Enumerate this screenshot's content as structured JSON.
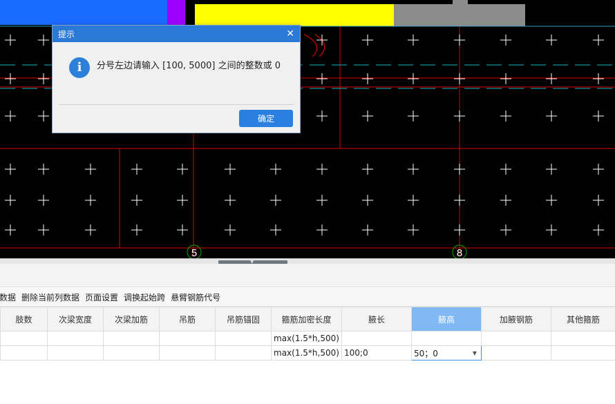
{
  "canvas": {
    "axis_labels": [
      "5",
      "8"
    ],
    "colors": {
      "background": "#000000",
      "beam_line": "#e00000",
      "dash_line": "#19b8c8",
      "cross": "#ffffff",
      "yellow_block": "#ffff00",
      "gray_block": "#8c8c8c",
      "blue_block": "#1a6cff",
      "purple_block": "#9b00ff"
    }
  },
  "dialog": {
    "title": "提示",
    "message": "分号左边请输入 [100, 5000] 之间的整数或 0",
    "ok_label": "确定",
    "icon": "info-icon"
  },
  "toolbar": {
    "items": [
      "数据",
      "删除当前列数据",
      "页面设置",
      "调换起始跨",
      "悬臂钢筋代号"
    ]
  },
  "table": {
    "columns": [
      "肢数",
      "次梁宽度",
      "次梁加筋",
      "吊筋",
      "吊筋锚固",
      "箍筋加密长度",
      "腋长",
      "腋高",
      "加腋钢筋",
      "其他箍筋"
    ],
    "selected_column": "腋高",
    "rows": [
      [
        "",
        "",
        "",
        "",
        "",
        "max(1.5*h,500)",
        "",
        "",
        "",
        ""
      ],
      [
        "",
        "",
        "",
        "",
        "",
        "max(1.5*h,500)",
        "100;0",
        "50；0",
        "",
        ""
      ]
    ]
  }
}
